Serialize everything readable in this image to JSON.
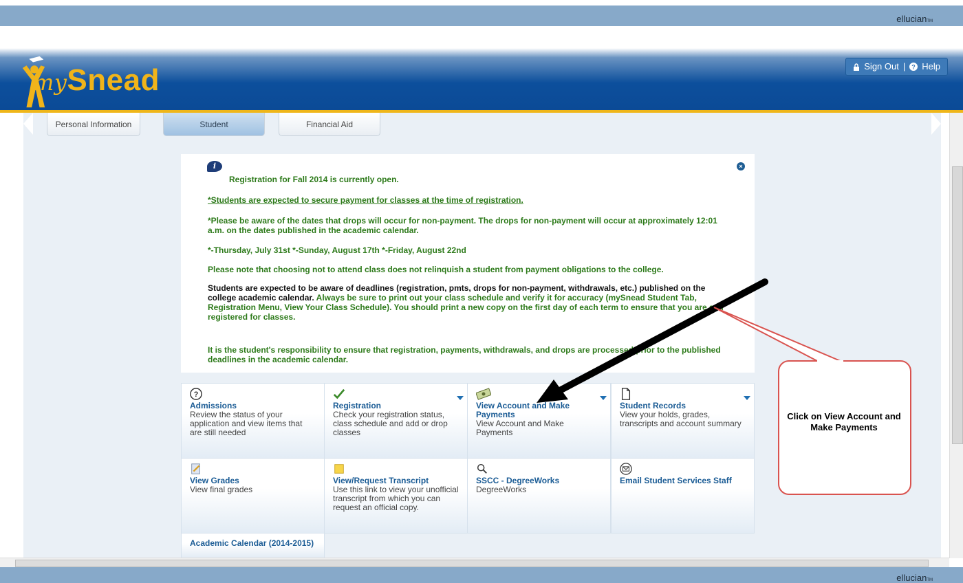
{
  "top_brand": "ellucian",
  "bottom_brand": "ellucian",
  "tm_mark": "TM",
  "header": {
    "logo_prefix": "my",
    "logo_name": "Snead",
    "sign_out": "Sign Out",
    "help": "Help"
  },
  "tabs": [
    "Personal Information",
    "Student",
    "Financial Aid"
  ],
  "notice": {
    "heading": "Registration for Fall 2014 is currently open.",
    "line1": "*Students are expected to secure payment for classes at the time of registration.",
    "line2": "*Please be aware of the dates that drops will occur for non-payment. The drops for non-payment will occur at approximately 12:01 a.m. on the dates published in the academic calendar.",
    "line3": "*-Thursday, July 31st *-Sunday, August 17th *-Friday, August 22nd",
    "line4": "Please note that choosing not to attend class does not relinquish a student from payment obligations to the college.",
    "line5_black": "Students are expected to be aware of deadlines (registration, pmts, drops for non-payment, withdrawals, etc.) published on the college academic calendar.",
    "line5_green": " Always be sure to print out your class schedule and verify it for accuracy (mySnead Student Tab, Registration Menu, View Your Class Schedule). You should print a new copy on the first day of each term to ensure that you are still registered for classes.",
    "line6": "It is the student's responsibility to ensure that registration, payments, withdrawals, and drops are processed prior to the published deadlines in the academic calendar."
  },
  "tiles": [
    {
      "title": "Admissions",
      "desc": "Review the status of your application and view items that are still needed",
      "icon": "question-circle-icon"
    },
    {
      "title": "Registration",
      "desc": "Check your registration status, class schedule and add or drop classes",
      "icon": "checkmark-icon"
    },
    {
      "title": "View Account and Make Payments",
      "desc": "View Account and Make Payments",
      "icon": "money-icon"
    },
    {
      "title": "Student Records",
      "desc": "View your holds, grades, transcripts and account summary",
      "icon": "document-icon"
    },
    {
      "title": "View Grades",
      "desc": "View final grades",
      "icon": "notepad-icon"
    },
    {
      "title": "View/Request Transcript",
      "desc": "Use this link to view your unofficial transcript from which you can request an official copy.",
      "icon": "sticky-note-icon"
    },
    {
      "title": "SSCC - DegreeWorks",
      "desc": "DegreeWorks",
      "icon": "search-icon"
    },
    {
      "title": "Email Student Services Staff",
      "desc": "",
      "icon": "envelope-icon"
    },
    {
      "title": "Academic Calendar (2014-2015)",
      "desc": "",
      "icon": ""
    }
  ],
  "callout": "Click on View Account and Make Payments",
  "colors": {
    "header_blue": "#0c4f9c",
    "gold": "#efb61a",
    "green_text": "#2d7a1a",
    "link_blue": "#1b5c95",
    "callout_red": "#d9534f"
  }
}
